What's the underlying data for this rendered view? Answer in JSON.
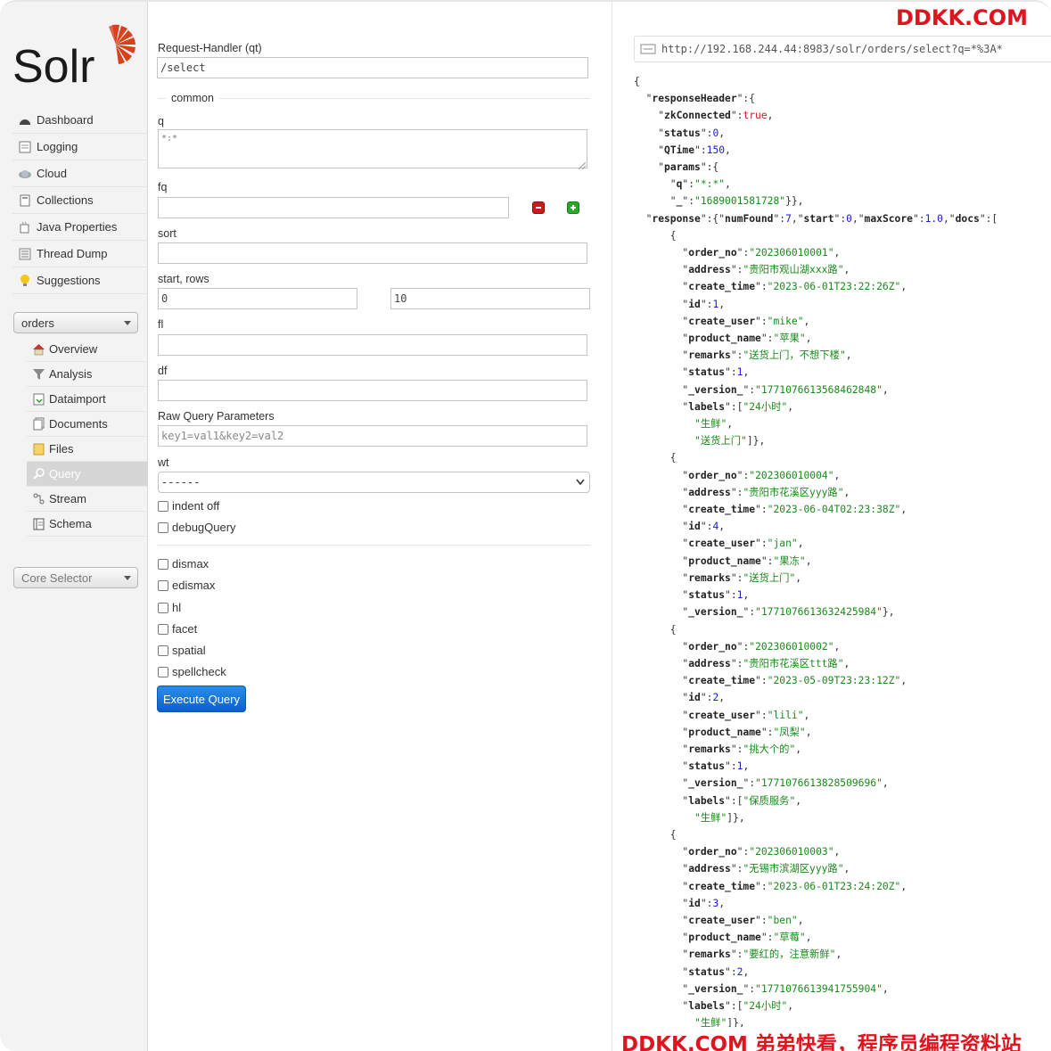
{
  "brand": {
    "name": "Solr",
    "accent_color": "#d9411e"
  },
  "nav": {
    "items": [
      {
        "label": "Dashboard",
        "icon": "dashboard-icon"
      },
      {
        "label": "Logging",
        "icon": "logging-icon"
      },
      {
        "label": "Cloud",
        "icon": "cloud-icon"
      },
      {
        "label": "Collections",
        "icon": "collections-icon"
      },
      {
        "label": "Java Properties",
        "icon": "java-icon"
      },
      {
        "label": "Thread Dump",
        "icon": "thread-dump-icon"
      },
      {
        "label": "Suggestions",
        "icon": "lightbulb-icon"
      }
    ],
    "collection_selector": "orders",
    "collection_items": [
      {
        "label": "Overview",
        "icon": "home-icon"
      },
      {
        "label": "Analysis",
        "icon": "funnel-icon"
      },
      {
        "label": "Dataimport",
        "icon": "import-icon"
      },
      {
        "label": "Documents",
        "icon": "documents-icon"
      },
      {
        "label": "Files",
        "icon": "folder-icon"
      },
      {
        "label": "Query",
        "icon": "magnifier-icon",
        "active": true
      },
      {
        "label": "Stream",
        "icon": "stream-icon"
      },
      {
        "label": "Schema",
        "icon": "schema-icon"
      }
    ],
    "core_selector": "Core Selector"
  },
  "form": {
    "request_handler_label": "Request-Handler (qt)",
    "request_handler_value": "/select",
    "common_legend": "common",
    "q_label": "q",
    "q_value": "*:*",
    "fq_label": "fq",
    "fq_value": "",
    "sort_label": "sort",
    "start_rows_label": "start, rows",
    "start_value": "0",
    "rows_value": "10",
    "fl_label": "fl",
    "df_label": "df",
    "raw_label": "Raw Query Parameters",
    "raw_placeholder": "key1=val1&key2=val2",
    "wt_label": "wt",
    "wt_value": "------",
    "indent_label": "indent off",
    "debug_label": "debugQuery",
    "options": [
      "dismax",
      "edismax",
      "hl",
      "facet",
      "spatial",
      "spellcheck"
    ],
    "execute_label": "Execute Query"
  },
  "results": {
    "url": "http://192.168.244.44:8983/solr/orders/select?q=*%3A*",
    "response_header": {
      "zkConnected": "true",
      "status": "0",
      "QTime": "150",
      "q": "*:*",
      "_": "1689001581728"
    },
    "response": {
      "numFound": "7",
      "start": "0",
      "maxScore": "1.0"
    },
    "docs": [
      {
        "order_no": "202306010001",
        "address": "贵阳市观山湖xxx路",
        "create_time": "2023-06-01T23:22:26Z",
        "id": "1",
        "create_user": "mike",
        "product_name": "苹果",
        "remarks": "送货上门，不想下楼",
        "status": "1",
        "_version_": "1771076613568462848",
        "labels": [
          "24小时",
          "生鲜",
          "送货上门"
        ]
      },
      {
        "order_no": "202306010004",
        "address": "贵阳市花溪区yyy路",
        "create_time": "2023-06-04T02:23:38Z",
        "id": "4",
        "create_user": "jan",
        "product_name": "果冻",
        "remarks": "送货上门",
        "status": "1",
        "_version_": "1771076613632425984",
        "labels": []
      },
      {
        "order_no": "202306010002",
        "address": "贵阳市花溪区ttt路",
        "create_time": "2023-05-09T23:23:12Z",
        "id": "2",
        "create_user": "lili",
        "product_name": "凤梨",
        "remarks": "挑大个的",
        "status": "1",
        "_version_": "1771076613828509696",
        "labels": [
          "保质服务",
          "生鲜"
        ]
      },
      {
        "order_no": "202306010003",
        "address": "无锡市滨湖区yyy路",
        "create_time": "2023-06-01T23:24:20Z",
        "id": "3",
        "create_user": "ben",
        "product_name": "草莓",
        "remarks": "要红的，注意新鲜",
        "status": "2",
        "_version_": "1771076613941755904",
        "labels": [
          "24小时",
          "生鲜"
        ]
      }
    ]
  },
  "watermark": {
    "top": "DDKK.COM",
    "bottom": "DDKK.COM 弟弟快看，程序员编程资料站",
    "color": "#e0141e"
  }
}
